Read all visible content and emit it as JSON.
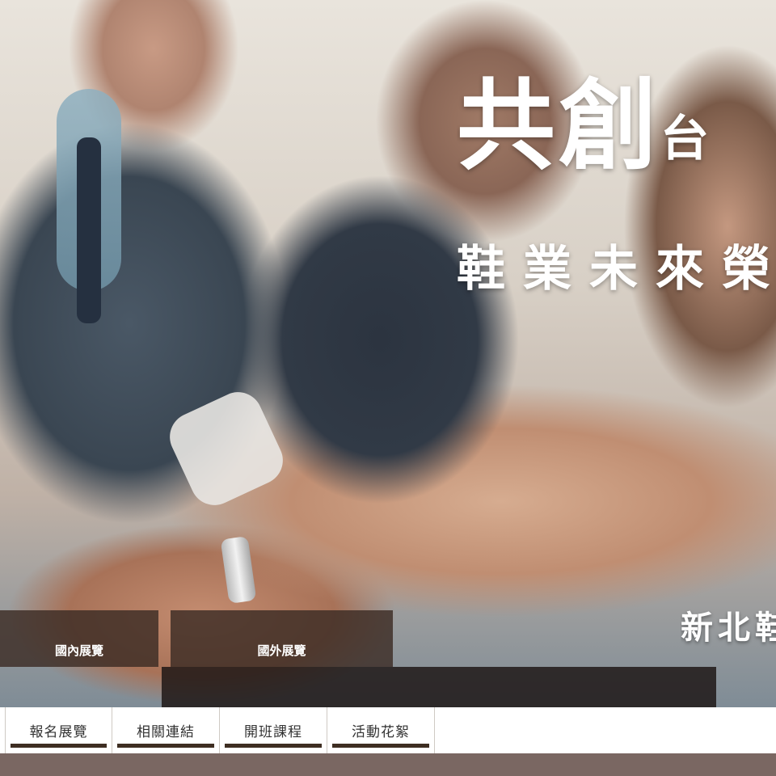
{
  "hero": {
    "headline_big": "共創",
    "headline_small": "台",
    "headline_line2": "鞋業未來榮",
    "org_label": "新北鞋"
  },
  "overlay_tabs": [
    {
      "label": "國內展覽"
    },
    {
      "label": "國外展覽"
    }
  ],
  "nav": {
    "items": [
      {
        "label": "報名展覽"
      },
      {
        "label": "相關連結"
      },
      {
        "label": "開班課程"
      },
      {
        "label": "活動花絮"
      }
    ]
  },
  "colors": {
    "overlay_tab": "#3c2c24",
    "nav_underline": "#3e2e22",
    "footer_band": "#7a6762"
  }
}
